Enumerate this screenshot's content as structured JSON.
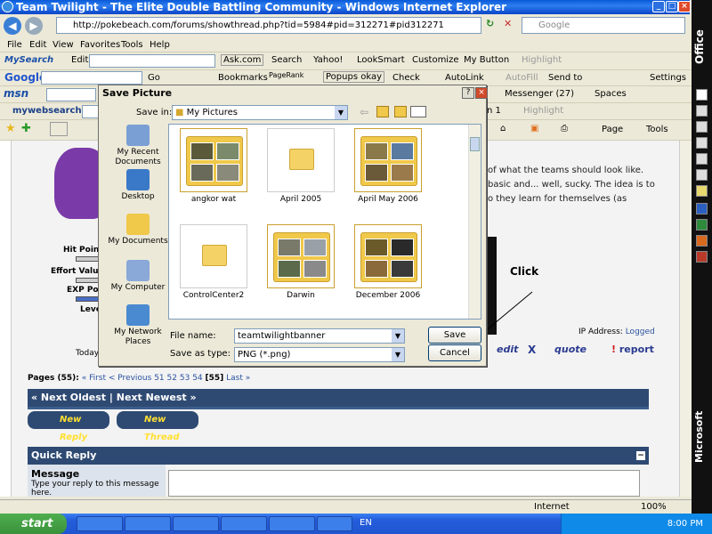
{
  "window": {
    "title": "Team Twilight - The Elite Double Battling Community - Windows Internet Explorer"
  },
  "address": {
    "url": "http://pokebeach.com/forums/showthread.php?tid=5984#pid=312271#pid312271",
    "search_placeholder": "Google"
  },
  "menu": [
    "File",
    "Edit",
    "View",
    "Favorites",
    "Tools",
    "Help"
  ],
  "toolbar_mysearch": {
    "label": "MySearch",
    "edit": "Edit",
    "ask": "Ask.com",
    "search": "Search",
    "yahoo": "Yahoo!",
    "looksmart": "LookSmart",
    "customize": "Customize",
    "mybutton": "My Button",
    "highlight": "Highlight"
  },
  "toolbar_google": {
    "label": "Google",
    "go": "Go",
    "bookmarks": "Bookmarks",
    "pagerank": "PageRank",
    "popups": "Popups okay",
    "check": "Check",
    "autolink": "AutoLink",
    "autofill": "AutoFill",
    "sendto": "Send to",
    "settings": "Settings"
  },
  "toolbar_msn": {
    "label": "msn",
    "messenger": "Messenger (27)",
    "spaces": "Spaces"
  },
  "toolbar_mywebsearch": {
    "label": "mywebsearch",
    "item": "n 1",
    "highlight": "Highlight"
  },
  "toolbar_ie": {
    "page": "Page",
    "tools": "Tools"
  },
  "office": {
    "label": "Office",
    "brand": "Microsoft"
  },
  "page": {
    "post_text_1": "of what the teams should look like.",
    "post_text_2": "basic and... well, sucky. The idea is to",
    "post_text_3": "o they learn for themselves (as",
    "stats": [
      "Hit Point",
      "Effort Value",
      "EXP Poin",
      "Leve"
    ],
    "today": "Today",
    "ip_label": "IP Address:",
    "ip_value": "Logged",
    "edit": "edit",
    "quote": "quote",
    "report": "report",
    "pages_label": "Pages (55):",
    "pages_first": "« First",
    "pages_prev": "< Previous",
    "pages_nums": [
      "51",
      "52",
      "53",
      "54"
    ],
    "pages_current": "[55]",
    "pages_last": "Last »",
    "next_oldest": "« Next Oldest",
    "next_newest": "Next Newest »",
    "new_reply": "New Reply",
    "new_thread": "New Thread",
    "quick_reply": "Quick Reply",
    "message_label": "Message",
    "message_hint": "Type your reply to this message here.",
    "collapse": "−"
  },
  "annotation": {
    "text": "Click"
  },
  "dialog": {
    "title": "Save Picture",
    "save_in_label": "Save in:",
    "save_in_value": "My Pictures",
    "places": [
      {
        "label": "My Recent Documents",
        "icon": "recent-documents-icon",
        "color": "#7a9fd4"
      },
      {
        "label": "Desktop",
        "icon": "desktop-icon",
        "color": "#3a78c8"
      },
      {
        "label": "My Documents",
        "icon": "my-documents-icon",
        "color": "#f0c84a"
      },
      {
        "label": "My Computer",
        "icon": "my-computer-icon",
        "color": "#8aa8d8"
      },
      {
        "label": "My Network Places",
        "icon": "network-places-icon",
        "color": "#4a8ad0"
      }
    ],
    "files": [
      {
        "name": "angkor wat",
        "type": "photo-folder"
      },
      {
        "name": "April 2005",
        "type": "folder"
      },
      {
        "name": "April May 2006",
        "type": "photo-folder"
      },
      {
        "name": "ControlCenter2",
        "type": "folder"
      },
      {
        "name": "Darwin",
        "type": "photo-folder"
      },
      {
        "name": "December 2006",
        "type": "photo-folder"
      }
    ],
    "filename_label": "File name:",
    "filename_value": "teamtwilightbanner",
    "type_label": "Save as type:",
    "type_value": "PNG (*.png)",
    "save_button": "Save",
    "cancel_button": "Cancel",
    "help": "?",
    "close": "×"
  },
  "status": {
    "zone": "Internet",
    "zoom": "100%"
  },
  "taskbar": {
    "start": "start",
    "lang": "EN",
    "clock": "8:00 PM"
  }
}
